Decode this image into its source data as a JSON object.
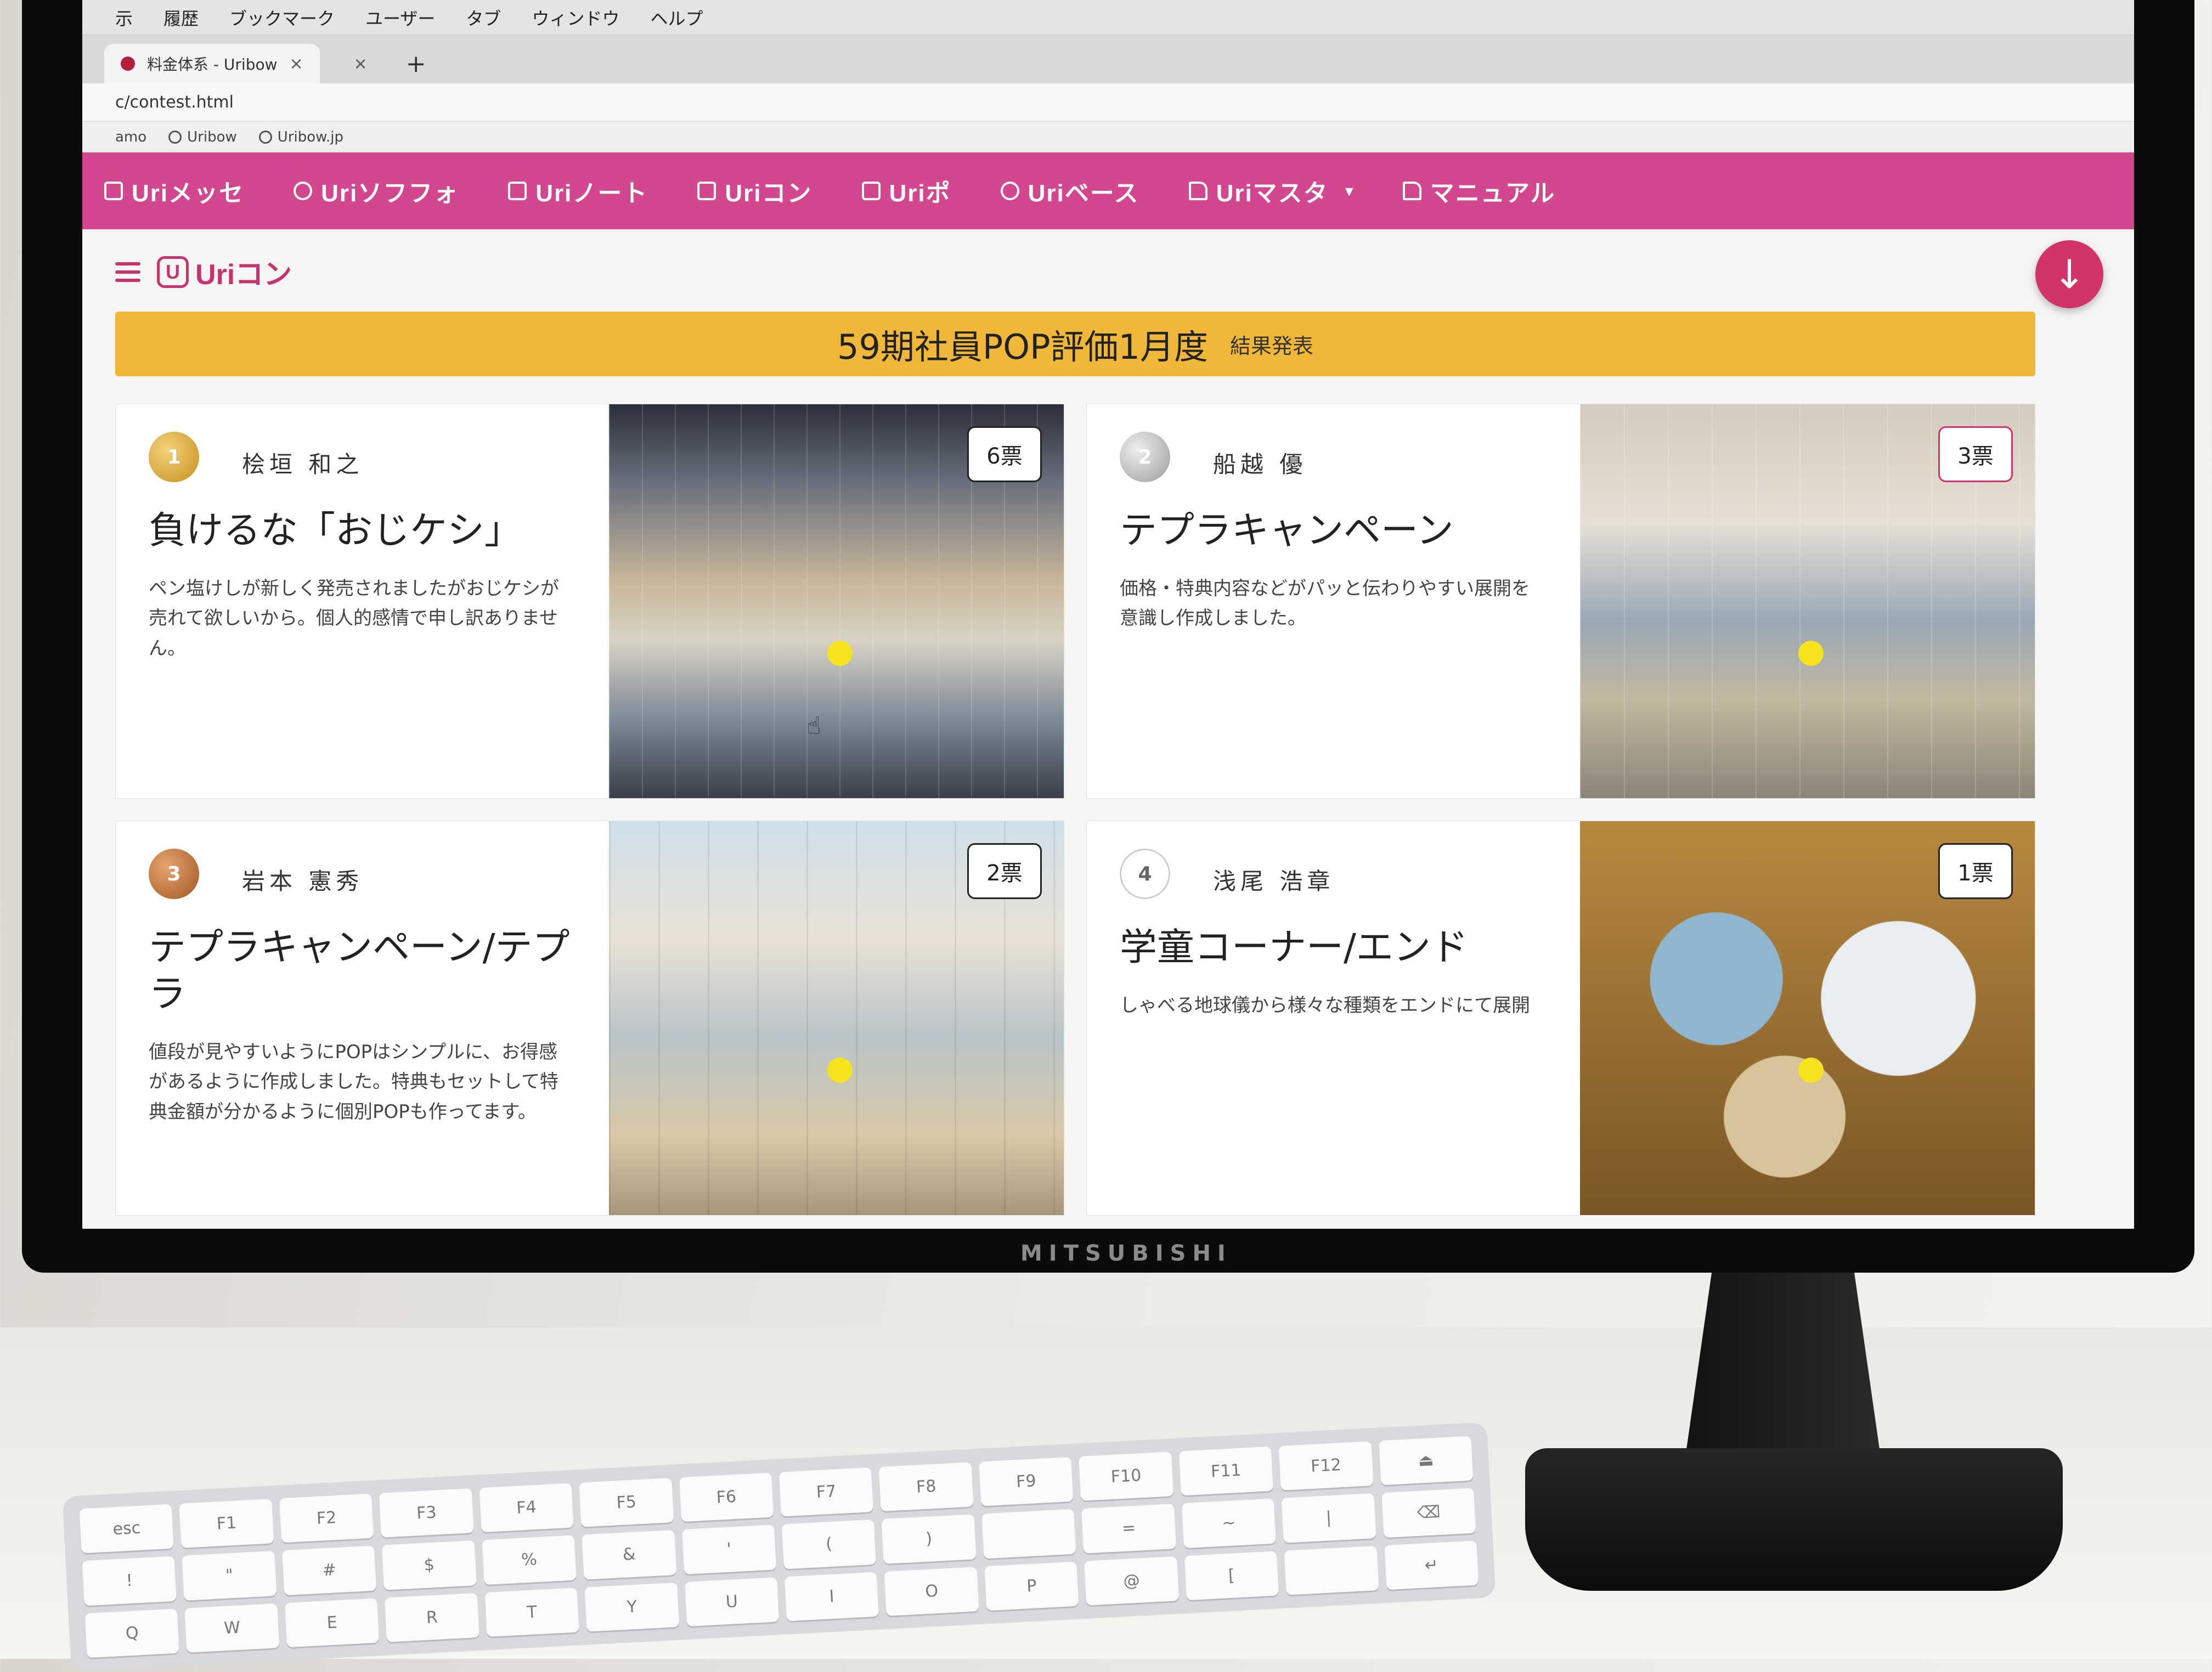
{
  "menubar": [
    "示",
    "履歴",
    "ブックマーク",
    "ユーザー",
    "タブ",
    "ウィンドウ",
    "ヘルプ"
  ],
  "tabs": [
    {
      "title": "料金体系 - Uribow",
      "close": "×"
    },
    {
      "title": "",
      "close": "×"
    }
  ],
  "new_tab": "+",
  "address": "c/contest.html",
  "bookmarks": [
    "amo",
    "Uribow",
    "Uribow.jp"
  ],
  "nav": {
    "items": [
      "Uriメッセ",
      "Uriソフフォ",
      "Uriノート",
      "Uriコン",
      "Uriポ",
      "Uriベース",
      "Uriマスタ",
      "マニュアル"
    ],
    "dropdown": "▾"
  },
  "logo": {
    "mark": "U",
    "text": "Uriコン"
  },
  "banner": {
    "title": "59期社員POP評価1月度",
    "sub": "結果発表"
  },
  "fab": {
    "label": "↓"
  },
  "cards": [
    {
      "rank": "1",
      "author": "桧垣 和之",
      "title": "負けるな「おじケシ」",
      "desc": "ペン塩けしが新しく発売されましたがおじケシが売れて欲しいから。個人的感情で申し訳ありません。",
      "votes": "6票"
    },
    {
      "rank": "2",
      "author": "船越 優",
      "title": "テプラキャンペーン",
      "desc": "価格・特典内容などがパッと伝わりやすい展開を意識し作成しました。",
      "votes": "3票"
    },
    {
      "rank": "3",
      "author": "岩本 憲秀",
      "title": "テプラキャンペーン/テプラ",
      "desc": "値段が見やすいようにPOPはシンプルに、お得感があるように作成しました。特典もセットして特典金額が分かるように個別POPも作ってます。",
      "votes": "2票"
    },
    {
      "rank": "4",
      "author": "浅尾 浩章",
      "title": "学童コーナー/エンド",
      "desc": "しゃべる地球儀から様々な種類をエンドにて展開",
      "votes": "1票"
    }
  ],
  "monitor_brand": "MITSUBISHI",
  "keyboard_keys": [
    "esc",
    "F1",
    "F2",
    "F3",
    "F4",
    "F5",
    "F6",
    "F7",
    "F8",
    "F9",
    "F10",
    "F11",
    "F12",
    "⏏",
    "!",
    "\"",
    "#",
    "$",
    "%",
    "&",
    "'",
    "(",
    ")",
    "",
    "=",
    "~",
    "|",
    "⌫",
    "Q",
    "W",
    "E",
    "R",
    "T",
    "Y",
    "U",
    "I",
    "O",
    "P",
    "@",
    "[",
    "",
    "↵"
  ]
}
